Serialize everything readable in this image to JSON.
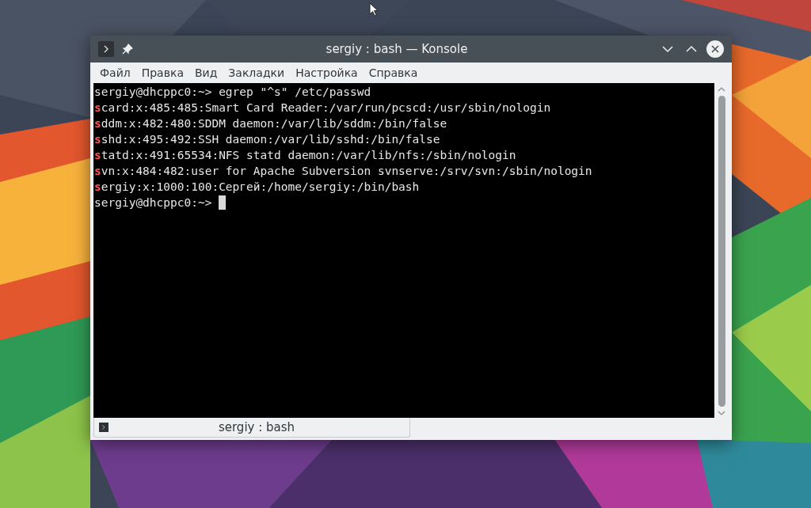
{
  "window": {
    "title": "sergiy : bash — Konsole"
  },
  "menu": [
    "Файл",
    "Правка",
    "Вид",
    "Закладки",
    "Настройка",
    "Справка"
  ],
  "terminal": {
    "lines": [
      {
        "kind": "command",
        "prompt": "sergiy@dhcppc0:~>",
        "text": "egrep \"^s\" /etc/passwd"
      },
      {
        "kind": "match",
        "match": "s",
        "text": "card:x:485:485:Smart Card Reader:/var/run/pcscd:/usr/sbin/nologin"
      },
      {
        "kind": "match",
        "match": "s",
        "text": "ddm:x:482:480:SDDM daemon:/var/lib/sddm:/bin/false"
      },
      {
        "kind": "match",
        "match": "s",
        "text": "shd:x:495:492:SSH daemon:/var/lib/sshd:/bin/false"
      },
      {
        "kind": "match",
        "match": "s",
        "text": "tatd:x:491:65534:NFS statd daemon:/var/lib/nfs:/sbin/nologin"
      },
      {
        "kind": "match",
        "match": "s",
        "text": "vn:x:484:482:user for Apache Subversion svnserve:/srv/svn:/sbin/nologin"
      },
      {
        "kind": "match",
        "match": "s",
        "text": "ergiy:x:1000:100:Сергей:/home/sergiy:/bin/bash"
      },
      {
        "kind": "command",
        "prompt": "sergiy@dhcppc0:~>",
        "cursor": true
      }
    ]
  },
  "tabs": [
    {
      "label": "sergiy : bash",
      "selected": true
    }
  ]
}
